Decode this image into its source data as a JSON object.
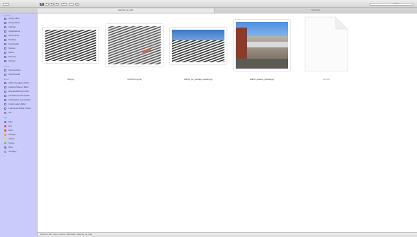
{
  "toolbar": {
    "view_buttons": [
      "▦",
      "☰",
      "▥",
      "▤"
    ],
    "arrange": "⚙ ▾",
    "share": "⇪",
    "tags": "◯",
    "search_placeholder": "Search",
    "search_icon": "search-icon"
  },
  "tabs": [
    {
      "label": "seleccion_de_fotos",
      "active": true
    },
    {
      "label": "Downloads",
      "active": false
    }
  ],
  "sidebar": {
    "favorites_heading": "Favorites",
    "favorites": [
      {
        "label": "All My Files",
        "icon": "all-files-icon"
      },
      {
        "label": "iCloud Drive",
        "icon": "cloud-icon"
      },
      {
        "label": "AirDrop",
        "icon": "airdrop-icon"
      },
      {
        "label": "Applications",
        "icon": "applications-icon"
      },
      {
        "label": "Documents",
        "icon": "documents-icon"
      },
      {
        "label": "Desktop",
        "icon": "desktop-icon"
      },
      {
        "label": "Downloads",
        "icon": "downloads-icon"
      },
      {
        "label": "Movies",
        "icon": "movies-icon"
      },
      {
        "label": "Music",
        "icon": "music-icon"
      },
      {
        "label": "Pictures",
        "icon": "pictures-icon"
      },
      {
        "label": "Photos",
        "icon": "photos-icon"
      }
    ],
    "devices_heading": "Devices",
    "devices": [
      {
        "label": "Remote Disc",
        "icon": "disc-icon"
      },
      {
        "label": "WINTOUSB",
        "icon": "drive-icon"
      }
    ],
    "shared_heading": "Shared",
    "shared": [
      {
        "label": "Abbie Douglas's MAC",
        "icon": "computer-icon"
      },
      {
        "label": "Andrew Stone's MAC",
        "icon": "computer-icon"
      },
      {
        "label": "Brenda Bishop's MAC",
        "icon": "computer-icon"
      },
      {
        "label": "Christina Amato's Mac",
        "icon": "computer-icon"
      },
      {
        "label": "Christopher Lee's MAC",
        "icon": "computer-icon"
      },
      {
        "label": "Cindy Lake's MAC",
        "icon": "computer-icon"
      },
      {
        "label": "Francesca Wilde's MAC",
        "icon": "computer-icon"
      },
      {
        "label": "All...",
        "icon": "network-icon"
      }
    ],
    "tags_heading": "Tags",
    "tags": [
      {
        "label": "Blue",
        "color": "#4a7bd8"
      },
      {
        "label": "Hot",
        "color": "#e8453c"
      },
      {
        "label": "Red",
        "color": "#e8453c"
      },
      {
        "label": "Orange",
        "color": "#f39a2b"
      },
      {
        "label": "Yellow",
        "color": "#f3d33a"
      },
      {
        "label": "Green",
        "color": "#5ec24a"
      },
      {
        "label": "Blue",
        "color": "#4a7bd8"
      },
      {
        "label": "All Tags...",
        "color": ""
      }
    ]
  },
  "files": [
    {
      "name": "IMG.jpg",
      "kind": "mesh-dark"
    },
    {
      "name": "DSC019.png.png",
      "kind": "mesh-hand"
    },
    {
      "name": "edificio_con_fachada_metalica.jpg",
      "kind": "mesh-sky"
    },
    {
      "name": "edificio_estacion_fachada.jpg",
      "kind": "photo"
    },
    {
      "name": "Sin titulo",
      "kind": "document"
    }
  ],
  "pathbar": {
    "text": "Macintosh HD › Users › usuario › Downloads › seleccion_de_fotos"
  }
}
